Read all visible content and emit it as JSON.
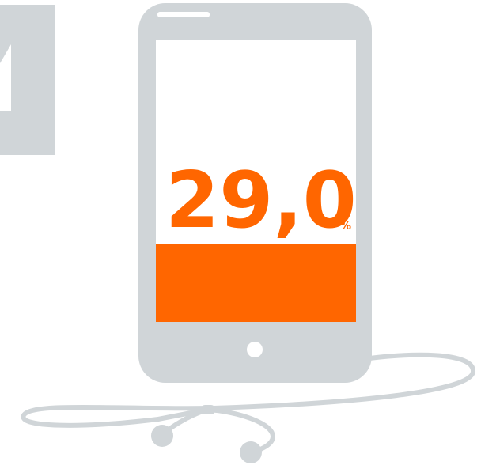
{
  "infographic": {
    "value": "29,0",
    "unit": "%",
    "level_percent": 29.0
  },
  "colors": {
    "device_gray": "#d0d5d8",
    "screen_white": "#ffffff",
    "accent_orange": "#ff6600"
  },
  "icons": [
    "smartphone-icon",
    "earphones-icon",
    "partial-device-icon"
  ]
}
